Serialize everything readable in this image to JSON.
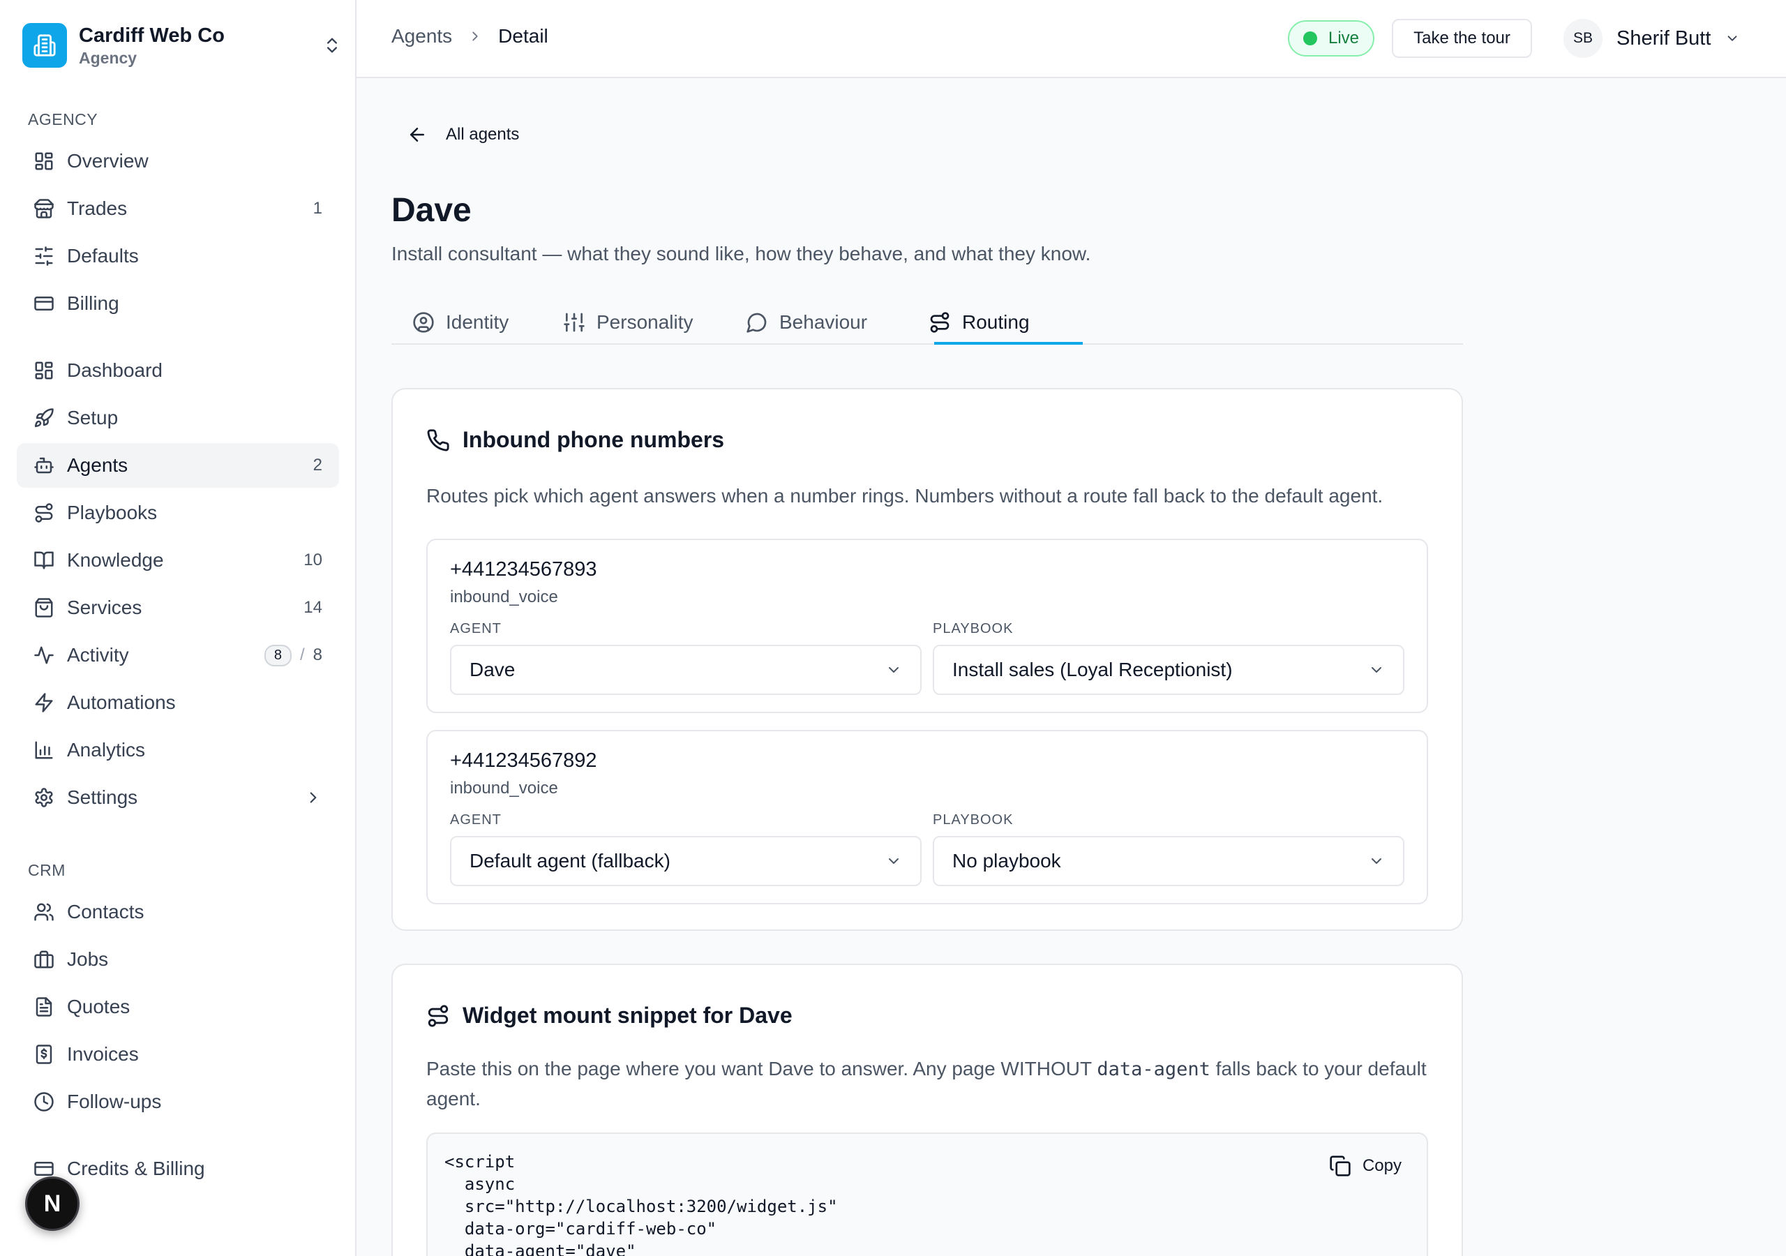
{
  "org": {
    "name": "Cardiff Web Co",
    "type": "Agency"
  },
  "sidebar": {
    "agency_label": "AGENCY",
    "crm_label": "CRM",
    "agency_items": [
      {
        "label": "Overview",
        "icon": "layout-dashboard-icon"
      },
      {
        "label": "Trades",
        "count": "1",
        "icon": "store-icon"
      },
      {
        "label": "Defaults",
        "icon": "sliders-icon"
      },
      {
        "label": "Billing",
        "icon": "credit-card-icon"
      }
    ],
    "main_items": [
      {
        "label": "Dashboard",
        "icon": "layout-dashboard-icon"
      },
      {
        "label": "Setup",
        "icon": "rocket-icon"
      },
      {
        "label": "Agents",
        "count": "2",
        "icon": "bot-icon",
        "active": true
      },
      {
        "label": "Playbooks",
        "icon": "route-icon"
      },
      {
        "label": "Knowledge",
        "count": "10",
        "icon": "book-open-icon"
      },
      {
        "label": "Services",
        "count": "14",
        "icon": "shopping-bag-icon"
      },
      {
        "label": "Activity",
        "badge": "8",
        "total": "8",
        "icon": "activity-icon"
      },
      {
        "label": "Automations",
        "icon": "zap-icon"
      },
      {
        "label": "Analytics",
        "icon": "bar-chart-icon"
      },
      {
        "label": "Settings",
        "icon": "gear-icon"
      }
    ],
    "crm_items": [
      {
        "label": "Contacts",
        "icon": "users-icon"
      },
      {
        "label": "Jobs",
        "icon": "briefcase-icon"
      },
      {
        "label": "Quotes",
        "icon": "file-text-icon"
      },
      {
        "label": "Invoices",
        "icon": "receipt-icon"
      },
      {
        "label": "Follow-ups",
        "icon": "clock-icon"
      },
      {
        "label": "Credits & Billing",
        "icon": "credit-card-icon"
      }
    ],
    "fab_label": "N"
  },
  "topbar": {
    "breadcrumb": [
      "Agents",
      "Detail"
    ],
    "status": "Live",
    "tour_button": "Take the tour",
    "user": {
      "initials": "SB",
      "name": "Sherif Butt"
    }
  },
  "page": {
    "back_label": "All agents",
    "title": "Dave",
    "subtitle": "Install consultant — what they sound like, how they behave, and what they know.",
    "tabs": [
      {
        "label": "Identity",
        "icon": "user-circle-icon"
      },
      {
        "label": "Personality",
        "icon": "sliders-vertical-icon"
      },
      {
        "label": "Behaviour",
        "icon": "message-circle-icon"
      },
      {
        "label": "Routing",
        "icon": "route-icon",
        "active": true
      }
    ]
  },
  "inbound": {
    "title": "Inbound phone numbers",
    "description": "Routes pick which agent answers when a number rings. Numbers without a route fall back to the default agent.",
    "agent_label": "AGENT",
    "playbook_label": "PLAYBOOK",
    "routes": [
      {
        "number": "+441234567893",
        "type": "inbound_voice",
        "agent": "Dave",
        "playbook": "Install sales (Loyal Receptionist)"
      },
      {
        "number": "+441234567892",
        "type": "inbound_voice",
        "agent": "Default agent (fallback)",
        "playbook": "No playbook"
      }
    ]
  },
  "widget": {
    "title": "Widget mount snippet for Dave",
    "desc_before": "Paste this on the page where you want Dave to answer. Any page WITHOUT ",
    "desc_code": "data-agent",
    "desc_after": " falls back to your default agent.",
    "copy_label": "Copy",
    "code": "<script\n  async\n  src=\"http://localhost:3200/widget.js\"\n  data-org=\"cardiff-web-co\"\n  data-agent=\"dave\""
  },
  "colors": {
    "accent": "#0ea5e9",
    "live": "#22c55e"
  }
}
